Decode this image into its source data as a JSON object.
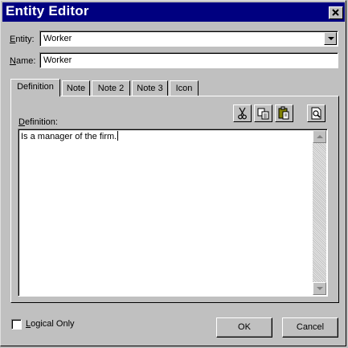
{
  "window": {
    "title": "Entity Editor"
  },
  "entity": {
    "label_prefix": "E",
    "label_rest": "ntity:",
    "value": "Worker"
  },
  "name": {
    "label_prefix": "N",
    "label_rest": "ame:",
    "value": "Worker"
  },
  "tabs": [
    {
      "label": "Definition",
      "active": true
    },
    {
      "label": "Note"
    },
    {
      "label": "Note 2"
    },
    {
      "label": "Note 3"
    },
    {
      "label": "Icon"
    }
  ],
  "definition": {
    "label_prefix": "D",
    "label_rest": "efinition:",
    "text": "Is a manager of the firm."
  },
  "toolbar": {
    "icons": [
      "scissors-icon",
      "copy-icon",
      "paste-icon",
      "preview-icon"
    ]
  },
  "logical_only": {
    "label_prefix": "L",
    "label_rest": "ogical Only",
    "checked": false
  },
  "buttons": {
    "ok": "OK",
    "cancel": "Cancel"
  },
  "colors": {
    "titlebar": "#000080",
    "face": "#c0c0c0"
  }
}
